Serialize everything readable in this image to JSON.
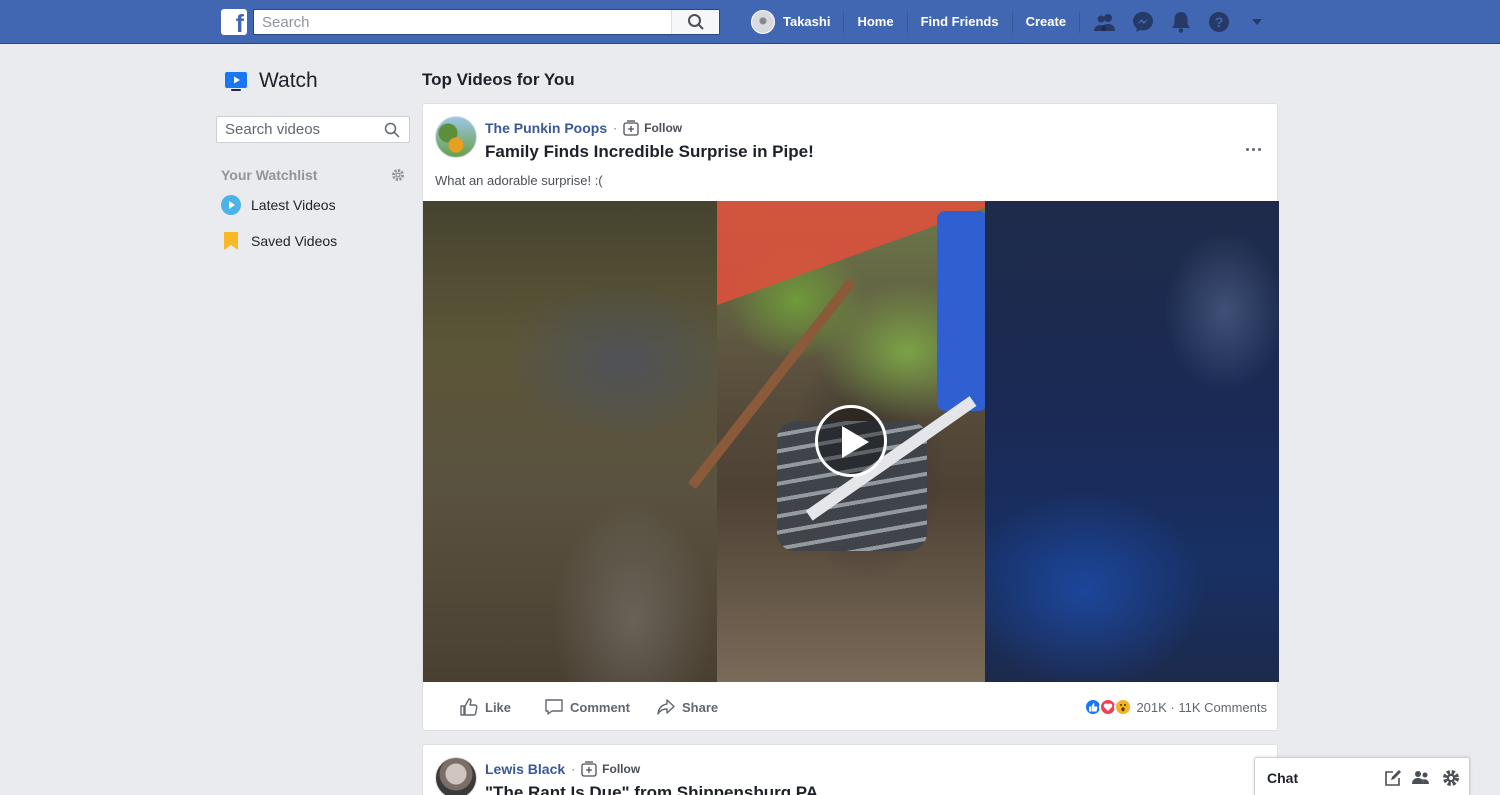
{
  "topbar": {
    "search_placeholder": "Search",
    "user_name": "Takashi",
    "nav": [
      "Home",
      "Find Friends",
      "Create"
    ]
  },
  "sidebar": {
    "title": "Watch",
    "search_placeholder": "Search videos",
    "watchlist_label": "Your Watchlist",
    "items": [
      {
        "label": "Latest Videos",
        "icon": "play-circle-icon"
      },
      {
        "label": "Saved Videos",
        "icon": "bookmark-icon"
      }
    ]
  },
  "main": {
    "section_title": "Top Videos for You",
    "posts": [
      {
        "page_name": "The Punkin Poops",
        "follow_label": "Follow",
        "title": "Family Finds Incredible Surprise in Pipe!",
        "text": "What an adorable surprise! :(",
        "actions": {
          "like": "Like",
          "comment": "Comment",
          "share": "Share"
        },
        "stats": "201K · 11K Comments"
      },
      {
        "page_name": "Lewis Black",
        "follow_label": "Follow",
        "title": "\"The Rant Is Due\" from Shippensburg PA"
      }
    ]
  },
  "chat": {
    "label": "Chat"
  },
  "colors": {
    "brand": "#4267b2",
    "link": "#385898",
    "background": "#e9ebee"
  }
}
